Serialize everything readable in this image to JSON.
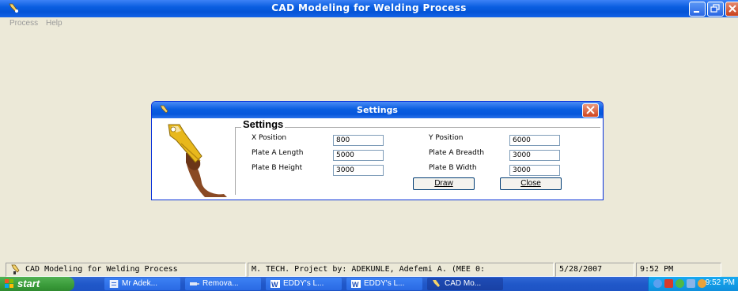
{
  "window": {
    "title": "CAD Modeling for Welding Process"
  },
  "menu": {
    "items": [
      "Process",
      "Help"
    ]
  },
  "dialog": {
    "title": "Settings",
    "group_label": "Settings",
    "fields": {
      "x_position": {
        "label": "X Position",
        "value": "800"
      },
      "y_position": {
        "label": "Y Position",
        "value": "6000"
      },
      "plate_a_length": {
        "label": "Plate A Length",
        "value": "5000"
      },
      "plate_a_breadth": {
        "label": "Plate A Breadth",
        "value": "3000"
      },
      "plate_b_height": {
        "label": "Plate B Height",
        "value": "3000"
      },
      "plate_b_width": {
        "label": "Plate B Width",
        "value": "3000"
      }
    },
    "buttons": {
      "draw": "Draw",
      "close": "Close"
    }
  },
  "statusbar": {
    "panels": [
      "CAD Modeling for Welding Process",
      "M. TECH. Project by: ADEKUNLE, Adefemi A. (MEE 0:",
      "5/28/2007",
      "9:52 PM"
    ]
  },
  "taskbar": {
    "start_label": "start",
    "buttons": [
      "Mr Adek...",
      "Remova...",
      "EDDY's L...",
      "EDDY's L...",
      "CAD Mo..."
    ],
    "clock": "9:52 PM"
  },
  "colors": {
    "titlebar": "#0a5ee0",
    "close_button": "#d1441e",
    "taskbar": "#2058c9",
    "start_button": "#3a9c3a",
    "tray": "#0f8fdc"
  }
}
